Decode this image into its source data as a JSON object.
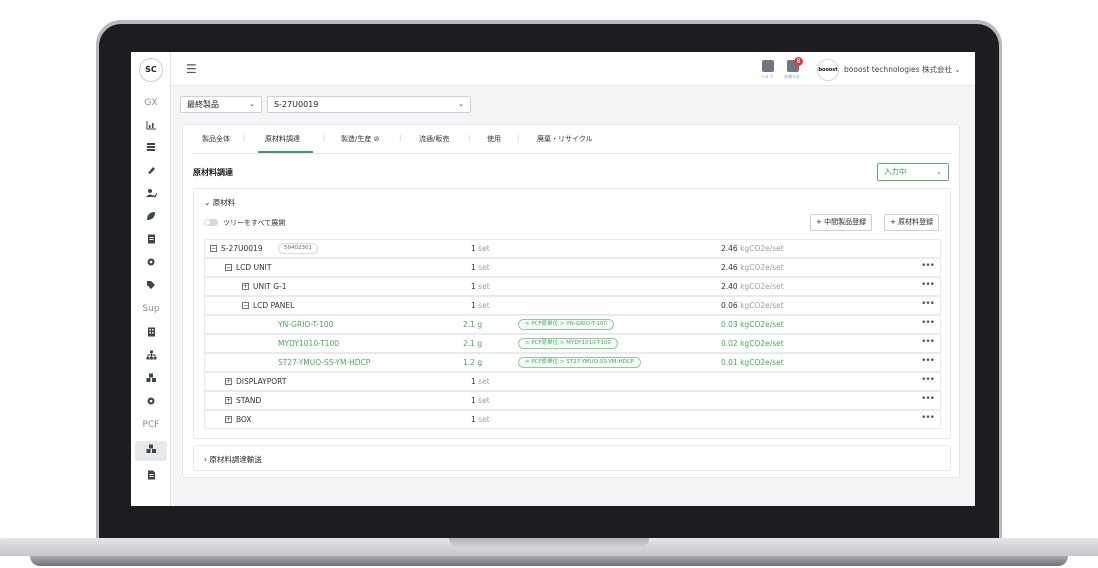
{
  "sidebar": {
    "logo": "SC",
    "group1": "GX",
    "group2": "Sup",
    "group3": "PCF",
    "icons": [
      "chart-icon",
      "layers-icon",
      "pencil-icon",
      "users-icon",
      "leaf-icon",
      "document-icon",
      "gear-icon",
      "tag-icon",
      "building-icon",
      "org-chart-icon",
      "blocks-icon",
      "gear-icon",
      "blocks-icon",
      "file-icon"
    ]
  },
  "topbar": {
    "help_label": "ヘルプ",
    "notifications_label": "お知らせ",
    "notification_count": "8",
    "avatar_text": "booost",
    "company": "booost technologies 株式会社 ⌄"
  },
  "filters": {
    "category": "最終製品",
    "product": "S-27U0019"
  },
  "tabs": [
    "製品全体",
    "原材料調達",
    "製造/生産 ⊘",
    "流通/販売",
    "使用",
    "廃棄・リサイクル"
  ],
  "section": {
    "title": "原材料調達",
    "status": "入力中"
  },
  "materials": {
    "heading": "原材料",
    "expand_label": "ツリーをすべて展開",
    "add_intermediate": "+ 中間製品登録",
    "add_material": "+ 原材料登録"
  },
  "tree": [
    {
      "name": "S-27U0019",
      "code": "59402301",
      "qty": "1",
      "unit": "set",
      "co2": "2.46",
      "co2_unit": "kgCO2e/set"
    },
    {
      "name": "LCD UNIT",
      "qty": "1",
      "unit": "set",
      "co2": "2.46",
      "co2_unit": "kgCO2e/set"
    },
    {
      "name": "UNIT G-1",
      "qty": "1",
      "unit": "set",
      "co2": "2.40",
      "co2_unit": "kgCO2e/set"
    },
    {
      "name": "LCD PANEL",
      "qty": "1",
      "unit": "set",
      "co2": "0.06",
      "co2_unit": "kgCO2e/set"
    },
    {
      "name": "YN-GRIO-T-100",
      "qty": "2.1",
      "unit": "g",
      "pcf": "PCF原単位 > YN-GRIO-T-100",
      "co2": "0.03",
      "co2_unit": "kgCO2e/set"
    },
    {
      "name": "MYDY1010-T100",
      "qty": "2.1",
      "unit": "g",
      "pcf": "PCF原単位 > MYDY1010-T100",
      "co2": "0.02",
      "co2_unit": "kgCO2e/set"
    },
    {
      "name": "ST27-YMUO-SS-YM-HDCP",
      "qty": "1.2",
      "unit": "g",
      "pcf": "PCF原単位 > ST27-YMUO-SS-YM-HDCP",
      "co2": "0.01",
      "co2_unit": "kgCO2e/set"
    },
    {
      "name": "DISPLAYPORT",
      "qty": "1",
      "unit": "set"
    },
    {
      "name": "STAND",
      "qty": "1",
      "unit": "set"
    },
    {
      "name": "BOX",
      "qty": "1",
      "unit": "set"
    }
  ],
  "transport": {
    "heading": "原材料調達輸送"
  },
  "colors": {
    "accent_green": "#47a85c",
    "badge_red": "#e23b3b"
  }
}
